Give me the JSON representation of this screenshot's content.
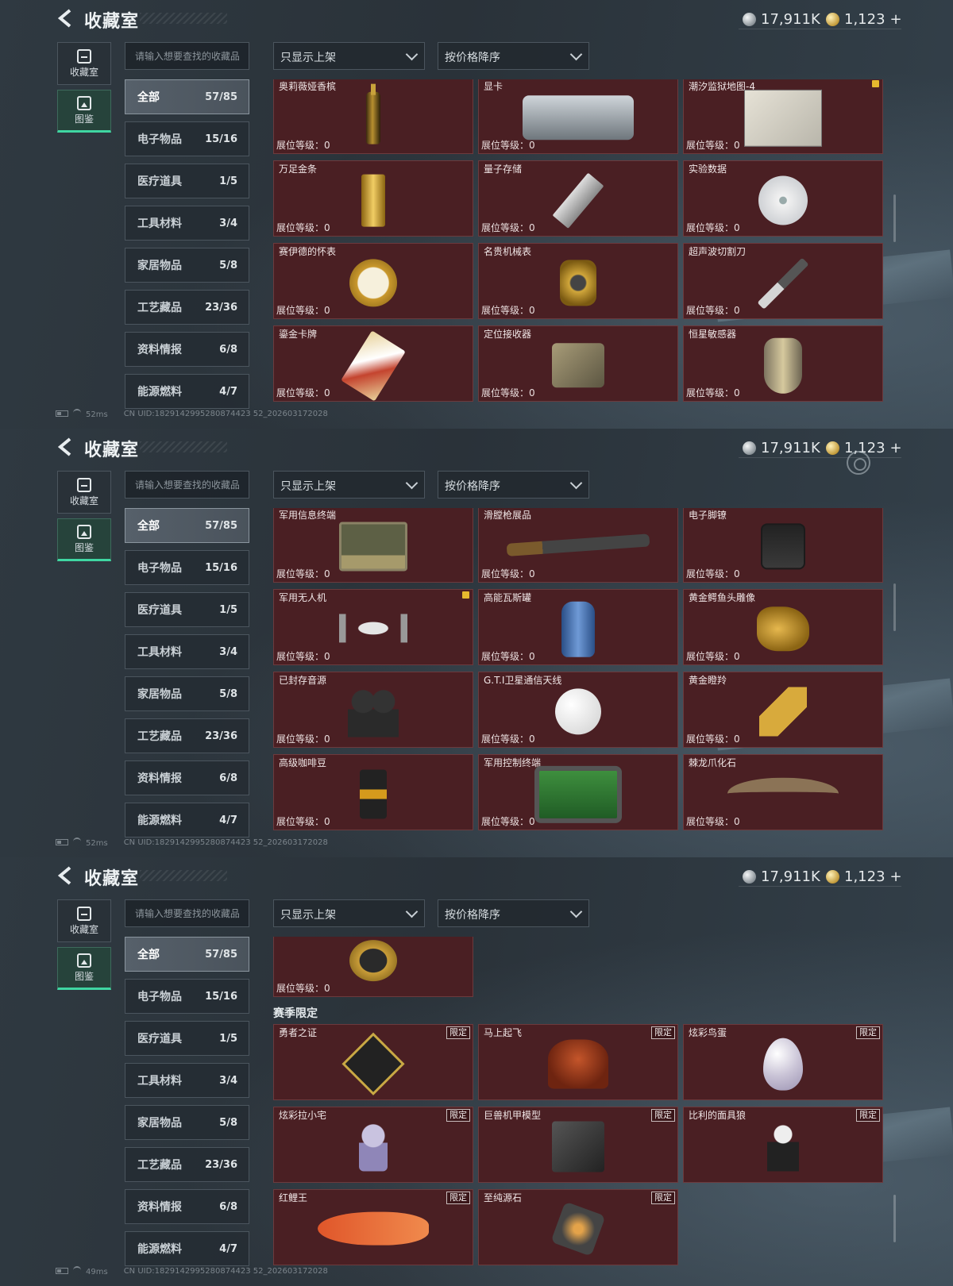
{
  "title": "收藏室",
  "currency": {
    "silver": "17,911K",
    "gold": "1,123",
    "plus": "+"
  },
  "nav": [
    {
      "label": "收藏室",
      "icon": "collection-room-icon"
    },
    {
      "label": "图鉴",
      "icon": "catalog-icon"
    }
  ],
  "search_placeholder": "请输入想要查找的收藏品",
  "filter": "只显示上架",
  "sort": "按价格降序",
  "categories": [
    {
      "label": "全部",
      "count": "57/85"
    },
    {
      "label": "电子物品",
      "count": "15/16"
    },
    {
      "label": "医疗道具",
      "count": "1/5"
    },
    {
      "label": "工具材料",
      "count": "3/4"
    },
    {
      "label": "家居物品",
      "count": "5/8"
    },
    {
      "label": "工艺藏品",
      "count": "23/36"
    },
    {
      "label": "资料情报",
      "count": "6/8"
    },
    {
      "label": "能源燃料",
      "count": "4/7"
    }
  ],
  "level_label": "展位等级：0",
  "limited_label": "限定",
  "season_label": "赛季限定",
  "screens": [
    {
      "ping": "52ms",
      "uid": "CN UID:1829142995280874423 52_202603172028",
      "items": [
        {
          "name": "奥莉薇娅香槟",
          "art": "bottle"
        },
        {
          "name": "显卡",
          "art": "gpu"
        },
        {
          "name": "潮汐监狱地图-4",
          "art": "map",
          "warn": true
        },
        {
          "name": "万足金条",
          "art": "gold"
        },
        {
          "name": "量子存储",
          "art": "usb"
        },
        {
          "name": "实验数据",
          "art": "disc"
        },
        {
          "name": "赛伊德的怀表",
          "art": "watch"
        },
        {
          "name": "名贵机械表",
          "art": "wristwatch"
        },
        {
          "name": "超声波切割刀",
          "art": "knife"
        },
        {
          "name": "鎏金卡牌",
          "art": "card-art"
        },
        {
          "name": "定位接收器",
          "art": "receiver"
        },
        {
          "name": "恒星敏感器",
          "art": "sensor"
        }
      ]
    },
    {
      "ping": "52ms",
      "uid": "CN UID:1829142995280874423 52_202603172028",
      "items": [
        {
          "name": "军用信息终端",
          "art": "laptop"
        },
        {
          "name": "滑膛枪展品",
          "art": "gun"
        },
        {
          "name": "电子脚镣",
          "art": "band"
        },
        {
          "name": "军用无人机",
          "art": "drone",
          "warn": true
        },
        {
          "name": "高能瓦斯罐",
          "art": "tank"
        },
        {
          "name": "黄金鳄鱼头雕像",
          "art": "croc"
        },
        {
          "name": "已封存音源",
          "art": "recorder"
        },
        {
          "name": "G.T.I卫星通信天线",
          "art": "dish"
        },
        {
          "name": "黄金瞪羚",
          "art": "deer"
        },
        {
          "name": "高级咖啡豆",
          "art": "coffee"
        },
        {
          "name": "军用控制终端",
          "art": "pad"
        },
        {
          "name": "棘龙爪化石",
          "art": "claw"
        }
      ]
    },
    {
      "ping": "49ms",
      "uid": "CN UID:1829142995280874423 52_202603172028",
      "top_items": [
        {
          "name": "",
          "art": "caviar"
        }
      ],
      "limited_items": [
        {
          "name": "勇者之证",
          "art": "badge"
        },
        {
          "name": "马上起飞",
          "art": "horse"
        },
        {
          "name": "炫彩鸟蛋",
          "art": "egg"
        },
        {
          "name": "炫彩拉小宅",
          "art": "doll"
        },
        {
          "name": "巨兽机甲模型",
          "art": "mech"
        },
        {
          "name": "比利的面具狼",
          "art": "puppet"
        },
        {
          "name": "红鲤王",
          "art": "fish"
        },
        {
          "name": "至纯源石",
          "art": "gem"
        }
      ]
    }
  ]
}
